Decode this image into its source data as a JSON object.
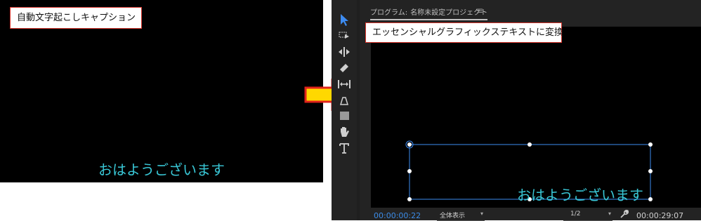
{
  "left": {
    "label": "自動文字起こしキャプション",
    "caption": "おはようございます"
  },
  "monitor": {
    "tab_prefix": "プログラム:",
    "tab_title": "名称未設定プロジェクト",
    "menu_icon": "≡",
    "label": "エッセンシャルグラフィックステキストに変換",
    "caption": "おはようございます"
  },
  "bottom_bar": {
    "current_timecode": "00:00:00:22",
    "fit": "全体表示",
    "resolution": "1/2",
    "duration_timecode": "00:00:29:07"
  },
  "tools": [
    "selection-icon",
    "track-select-icon",
    "ripple-edit-icon",
    "razor-icon",
    "slip-icon",
    "pen-icon",
    "rectangle-icon",
    "hand-icon",
    "type-icon"
  ],
  "colors": {
    "caption": "#39c7d6",
    "timecode": "#3b8be6",
    "label_border": "#d9342b",
    "arrow_fill": "#ffd800",
    "arrow_stroke": "#e0221b",
    "selection_tool": "#3d8bf0"
  }
}
